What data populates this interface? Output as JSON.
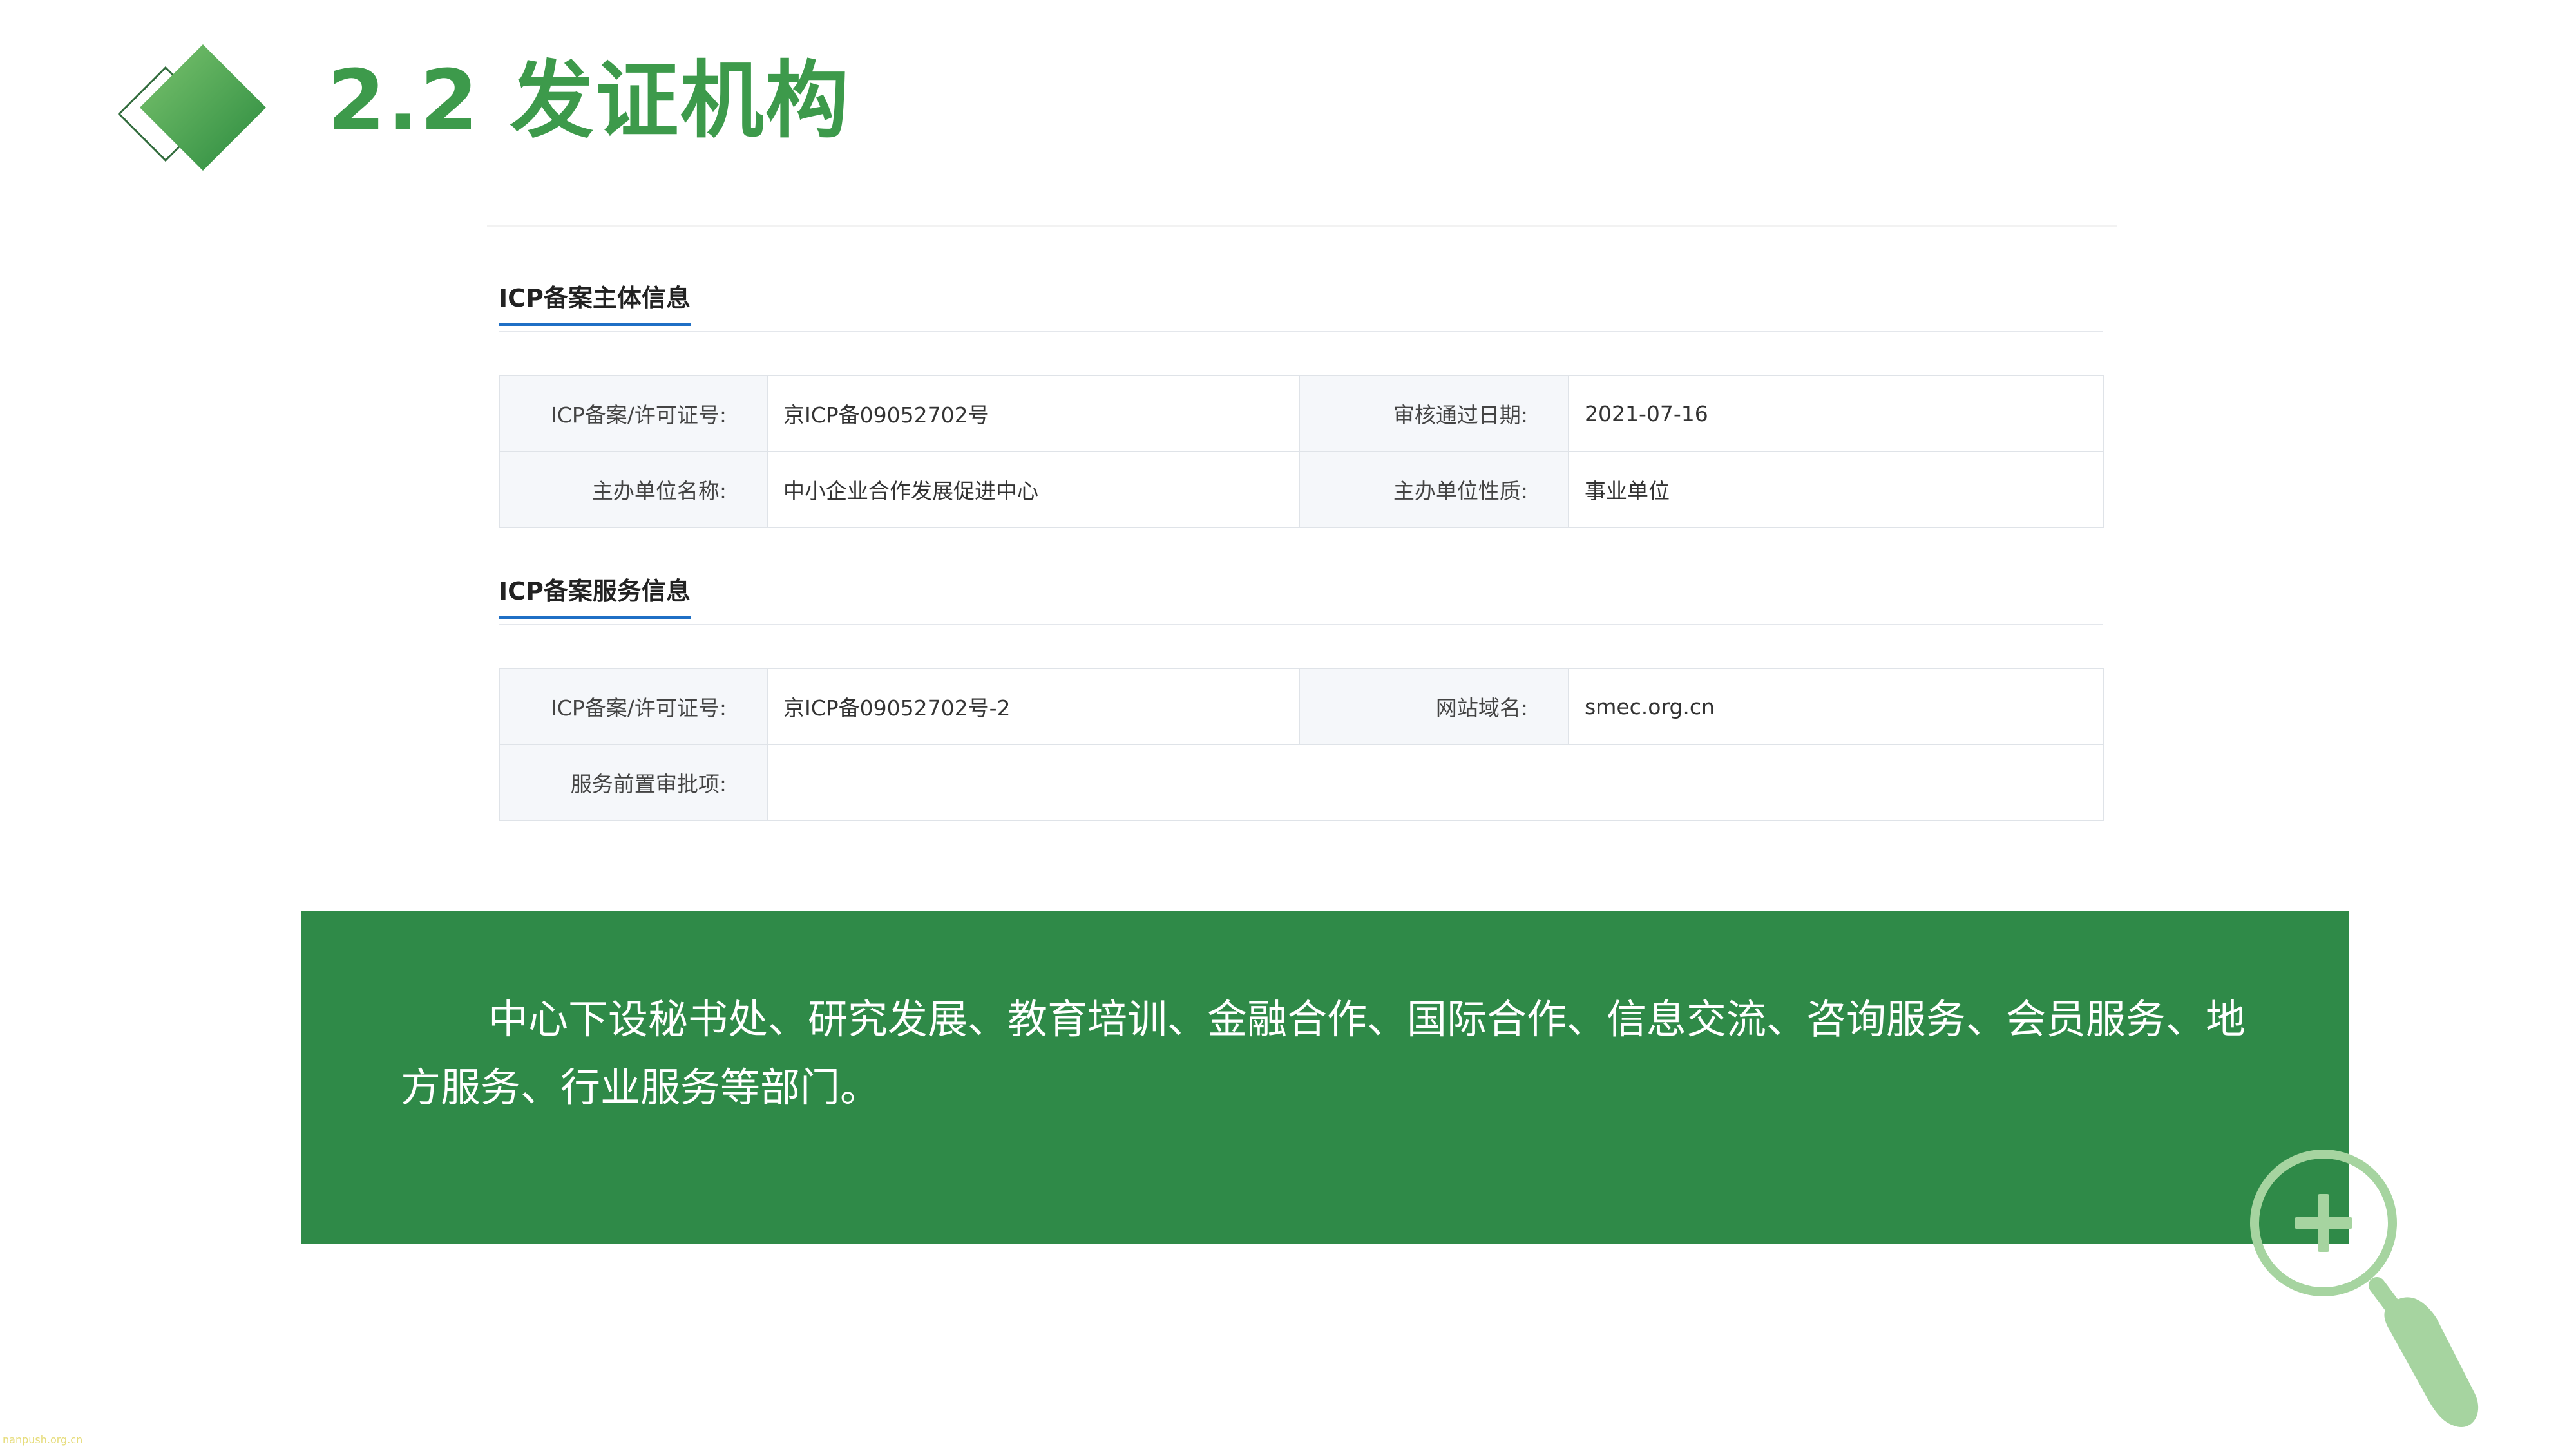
{
  "title": "2.2 发证机构",
  "section_subject": {
    "heading": "ICP备案主体信息",
    "rows": [
      {
        "label1": "ICP备案/许可证号:",
        "value1": "京ICP备09052702号",
        "label2": "审核通过日期:",
        "value2": "2021-07-16"
      },
      {
        "label1": "主办单位名称:",
        "value1": "中小企业合作发展促进中心",
        "label2": "主办单位性质:",
        "value2": "事业单位"
      }
    ]
  },
  "section_service": {
    "heading": "ICP备案服务信息",
    "rows": [
      {
        "label1": "ICP备案/许可证号:",
        "value1": "京ICP备09052702号-2",
        "label2": "网站域名:",
        "value2": "smec.org.cn"
      },
      {
        "label1": "服务前置审批项:",
        "value1": ""
      }
    ]
  },
  "description": "中心下设秘书处、研究发展、教育培训、金融合作、国际合作、信息交流、咨询服务、会员服务、地方服务、行业服务等部门。",
  "watermark": "nanpush.org.cn",
  "colors": {
    "title_green": "#3d9a4b",
    "panel_green": "#2f8a48",
    "magnifier_green": "#a6d4a0",
    "heading_underline": "#1f6fc5"
  },
  "icons": [
    "diamond-title-icon",
    "magnifier-plus-icon"
  ]
}
